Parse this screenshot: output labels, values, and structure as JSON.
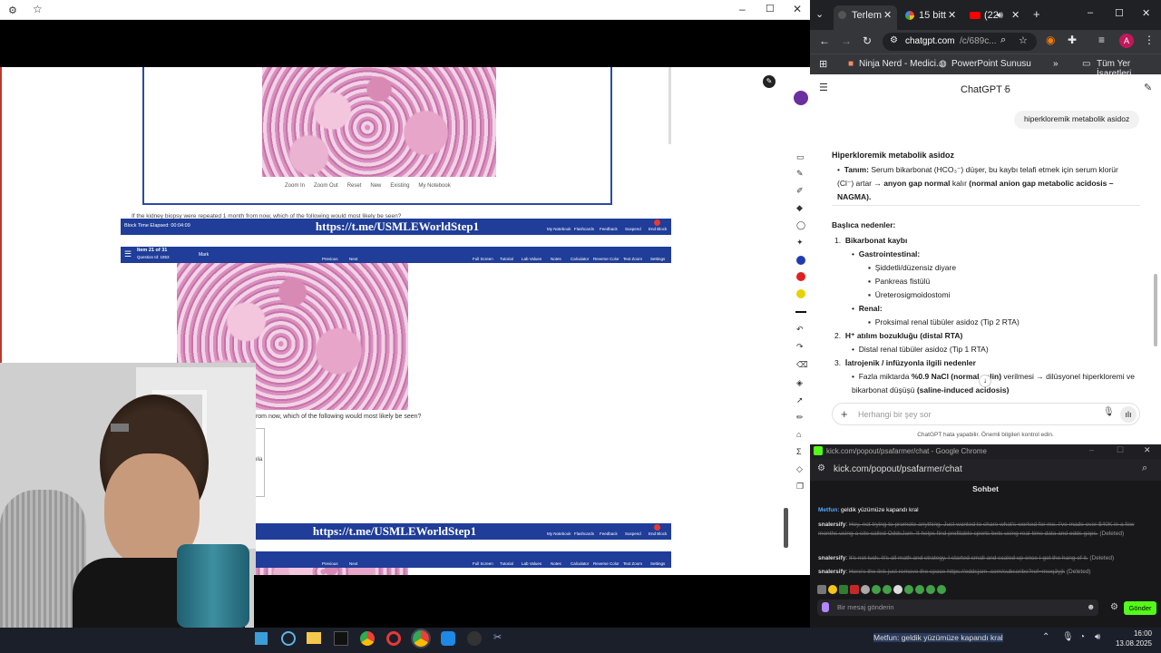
{
  "viewer": {
    "zoom_tools": [
      "Zoom In",
      "Zoom Out",
      "Reset",
      "New",
      "Existing",
      "My Notebook"
    ],
    "question_snippet_1": "If the kidney biopsy were repeated 1 month from now, which of the following would most likely be seen?",
    "question_snippet_2": "from now, which of the following would most likely be seen?",
    "block_time": "Block Time Elapsed: 00:04:09",
    "telegram_link": "https://t.me/USMLEWorldStep1",
    "item_label": "Item 21 of 31",
    "question_id": "Question Id: 1853",
    "mark_label": "Mark",
    "nav": [
      "Previous",
      "Next"
    ],
    "top_tools": [
      "Full Screen",
      "Tutorial",
      "Lab Values",
      "Notes",
      "Calculator",
      "Reverse Color",
      "Text Zoom",
      "Settings"
    ],
    "bottom_tools": [
      "My Notebook",
      "Flashcards",
      "Feedback",
      "Suspend",
      "End Block"
    ],
    "side_text": "ulia"
  },
  "chrome": {
    "tabs": [
      "Terlem",
      "15 bitt",
      "(22"
    ],
    "url_host": "chatgpt.com",
    "url_path": "/c/689c...",
    "bookmarks": [
      "Ninja Nerd - Medici...",
      "PowerPoint Sunusu"
    ],
    "all_bookmarks": "Tüm Yer İşaretleri",
    "avatar": "A"
  },
  "chatgpt": {
    "model": "ChatGPT 5",
    "user_msg": "hiperkloremik metabolik asidoz",
    "heading": "Hiperkloremik metabolik asidoz",
    "def_label": "Tanım:",
    "def_text": "Serum bikarbonat (HCO₃⁻) düşer, bu kaybı telafi etmek için serum klorür (Cl⁻) artar",
    "def_arrow": "→ anyon gap normal",
    "def_tail": "kalır",
    "def_paren": "(normal anion gap metabolic acidosis – NAGMA).",
    "causes_heading": "Başlıca nedenler:",
    "c1": "1.",
    "c1_title": "Bikarbonat kaybı",
    "gi": "Gastrointestinal:",
    "gi_items": [
      "Şiddetli/düzensiz diyare",
      "Pankreas fistülü",
      "Üreterosigmoidostomi"
    ],
    "renal": "Renal:",
    "renal_items": [
      "Proksimal renal tübüler asidoz (Tip 2 RTA)"
    ],
    "c2": "2.",
    "c2_title": "H⁺ atılım bozukluğu (distal RTA)",
    "c2_items": [
      "Distal renal tübüler asidoz (Tip 1 RTA)"
    ],
    "c3": "3.",
    "c3_title": "İatrojenik / infüzyonla ilgili nedenler",
    "c3_text_a": "Fazla miktarda",
    "c3_text_b": "%0.9 NaCl (normal salin)",
    "c3_text_c": "verilmesi → dilüsyonel hiperkloremi ve bikarbonat düşüşü",
    "c3_text_d": "(saline-induced acidosis)",
    "input_placeholder": "Herhangi bir şey sor",
    "disclaimer": "ChatGPT hata yapabilir. Önemli bilgileri kontrol edin."
  },
  "kick": {
    "window_title": "kick.com/popout/psafarmer/chat - Google Chrome",
    "url": "kick.com/popout/psafarmer/chat",
    "header": "Sohbet",
    "messages": [
      {
        "user": "Metfun",
        "text": "geldik yüzümüze kapandı kral",
        "deleted": ""
      },
      {
        "user": "snalersify",
        "text": "Hey, not trying to promote anything. Just wanted to share what's worked for me. I've made over $40K in a few months using a site called OddsJam. It helps find profitable sports bets using real-time data and odds gaps.",
        "deleted": "(Deleted)"
      },
      {
        "user": "snalersify",
        "text": "It's not luck. It's all math and strategy. I started small and scaled up once I got the hang of it.",
        "deleted": "(Deleted)"
      },
      {
        "user": "snalersify",
        "text": "Here's the link just remove the space https://oddsjam .com/subscribe?ref=mwq3yjk",
        "deleted": "(Deleted)"
      }
    ],
    "input_placeholder": "Bir mesaj gönderin",
    "send": "Gönder"
  },
  "taskbar": {
    "time": "16:00",
    "date": "13.08.2025",
    "ticker": "Metfun: geldik yüzümüze kapandı kral"
  },
  "colors": {
    "uworld_blue": "#1f3d99",
    "kick_green": "#53fc18",
    "chrome_dark": "#202124"
  }
}
